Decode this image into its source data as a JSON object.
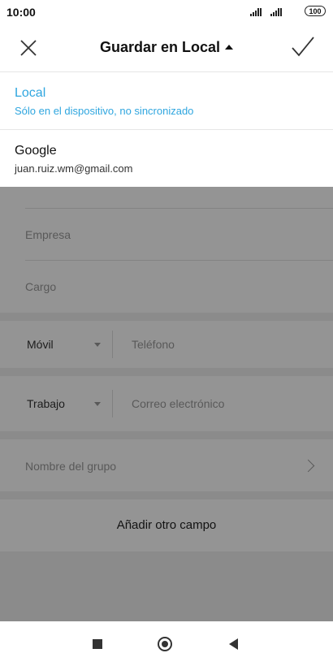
{
  "status_bar": {
    "time": "10:00",
    "battery": "100"
  },
  "header": {
    "title": "Guardar en Local"
  },
  "dropdown": {
    "options": [
      {
        "name": "Local",
        "subtitle": "Sólo en el dispositivo, no sincronizado"
      },
      {
        "name": "Google",
        "subtitle": "juan.ruiz.wm@gmail.com"
      }
    ]
  },
  "form": {
    "company_placeholder": "Empresa",
    "title_placeholder": "Cargo",
    "phone": {
      "type": "Móvil",
      "placeholder": "Teléfono"
    },
    "email": {
      "type": "Trabajo",
      "placeholder": "Correo electrónico"
    },
    "group_placeholder": "Nombre del grupo",
    "add_field_label": "Añadir otro campo"
  },
  "colors": {
    "accent": "#2fa6df",
    "overlay": "rgba(0,0,0,0.42)"
  },
  "icons": [
    "close-icon",
    "caret-up-icon",
    "check-icon",
    "chevron-right-icon",
    "recents-icon",
    "home-icon",
    "back-icon"
  ]
}
